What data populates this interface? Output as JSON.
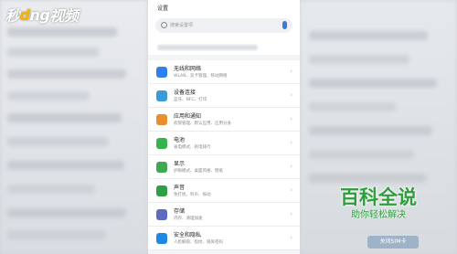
{
  "watermark_top": {
    "text_a": "秒",
    "text_b": "d",
    "text_c": "ng",
    "text_d": "视频"
  },
  "topbar": {
    "title": "设置"
  },
  "search": {
    "placeholder": "搜索设置项"
  },
  "settings": {
    "items": [
      {
        "title": "无线和网络",
        "subtitle": "WLAN、双卡管理、移动网络",
        "icon": "wifi-icon",
        "color": "#2f80ed"
      },
      {
        "title": "设备连接",
        "subtitle": "蓝牙、NFC、打印",
        "icon": "device-connect-icon",
        "color": "#3a9bd9"
      },
      {
        "title": "应用和通知",
        "subtitle": "权限管理、默认应用、应用分身",
        "icon": "apps-icon",
        "color": "#e9902c"
      },
      {
        "title": "电池",
        "subtitle": "省电模式、耗电排行",
        "icon": "battery-icon",
        "color": "#37b24d"
      },
      {
        "title": "显示",
        "subtitle": "护眼模式、桌面风格、壁纸",
        "icon": "display-icon",
        "color": "#40a850"
      },
      {
        "title": "声音",
        "subtitle": "免打扰、铃声、振动",
        "icon": "sound-icon",
        "color": "#2f9e44"
      },
      {
        "title": "存储",
        "subtitle": "内存、清理加速",
        "icon": "storage-icon",
        "color": "#5c6bc0"
      },
      {
        "title": "安全和隐私",
        "subtitle": "人脸解锁、指纹、锁屏密码",
        "icon": "shield-icon",
        "color": "#1e88e5"
      }
    ]
  },
  "brand": {
    "name": "百科全说",
    "tagline": "助你轻松解决"
  },
  "right_button": "关闭SIM卡"
}
